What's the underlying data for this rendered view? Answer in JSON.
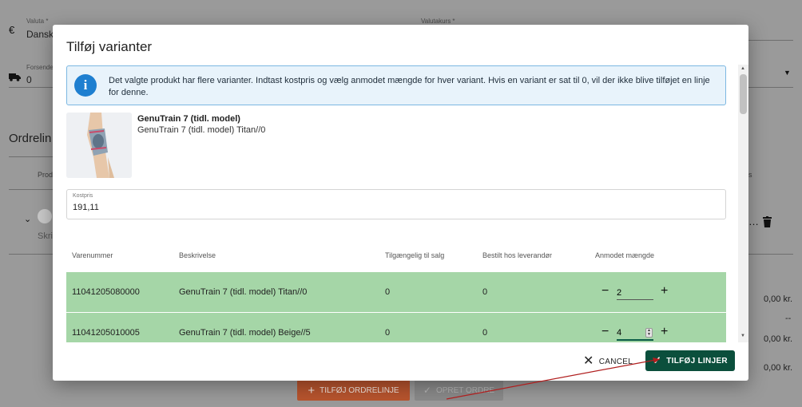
{
  "background": {
    "valuta_label": "Valuta *",
    "valuta_value": "Danske",
    "valutakurs_label": "Valutakurs *",
    "forsendelse_label": "Forsende",
    "forsendelse_value": "0",
    "section_title": "Ordrelin",
    "col_product": "Prod",
    "comment_placeholder": "Skri",
    "amount_1": "0,00 kr.",
    "amount_2": "--",
    "amount_3": "0,00 kr.",
    "amount_4": "0,00 kr.",
    "add_line_button": "TILFØJ ORDRELINJE",
    "create_order_button": "OPRET ORDRE",
    "col_s": "s"
  },
  "dialog": {
    "title": "Tilføj varianter",
    "info_text": "Det valgte produkt har flere varianter. Indtast kostpris og vælg anmodet mængde for hver variant. Hvis en variant er sat til 0, vil der ikke blive tilføjet en linje for denne.",
    "product": {
      "name": "GenuTrain 7 (tidl. model)",
      "variant": "GenuTrain 7 (tidl. model) Titan//0"
    },
    "cost": {
      "label": "Kostpris",
      "value": "191,11"
    },
    "table": {
      "headers": [
        "Varenummer",
        "Beskrivelse",
        "Tilgængelig til salg",
        "Bestilt hos leverandør",
        "Anmodet mængde"
      ],
      "rows": [
        {
          "item_no": "11041205080000",
          "description": "GenuTrain 7 (tidl. model) Titan//0",
          "available": "0",
          "ordered": "0",
          "qty": "2"
        },
        {
          "item_no": "11041205010005",
          "description": "GenuTrain 7 (tidl. model) Beige//5",
          "available": "0",
          "ordered": "0",
          "qty": "4"
        }
      ]
    },
    "cancel_label": "CANCEL",
    "add_lines_label": "TILFØJ LINJER"
  },
  "colors": {
    "primary": "#0b4f3c",
    "row_highlight": "#a5d6a7",
    "info_bg": "#e8f3fb",
    "info_icon": "#1e7fd0",
    "annotation": "#b01e1e",
    "bg_add_button": "#b7542e"
  },
  "icons": {
    "currency": "euro-icon",
    "shipping": "truck-icon",
    "info": "info-icon",
    "cancel": "close-icon",
    "confirm": "check-icon",
    "delete": "trash-icon"
  }
}
